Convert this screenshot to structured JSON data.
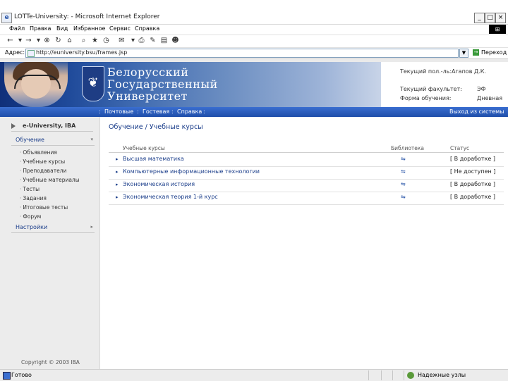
{
  "window": {
    "title": "LOTTe-University: - Microsoft Internet Explorer",
    "minimize": "_",
    "maximize": "□",
    "close": "×"
  },
  "menu": {
    "items": [
      "Файл",
      "Правка",
      "Вид",
      "Избранное",
      "Сервис",
      "Справка"
    ]
  },
  "address": {
    "label": "Адрес:",
    "url": "http://euniversity.bsu/frames.jsp",
    "go_label": "Переход"
  },
  "header": {
    "university_lines": [
      "Белорусский",
      "Государственный",
      "Университет"
    ],
    "user_label": "Текущий пол.-ль:",
    "user_name": "Агапов Д.К.",
    "faculty_label": "Текущий факультет:",
    "faculty_value": "ЭФ",
    "form_label": "Форма обучения:",
    "form_value": "Дневная"
  },
  "nav": {
    "links": [
      "Почтовые",
      "Гостевая",
      "Справка"
    ],
    "logout": "Выход из системы"
  },
  "sidebar": {
    "brand": "e-University, IBA",
    "section_learning": "Обучение",
    "items": [
      "Объявления",
      "Учебные курсы",
      "Преподаватели",
      "Учебные материалы",
      "Тесты",
      "Задания",
      "Итоговые тесты",
      "Форум"
    ],
    "section_settings": "Настройки",
    "copyright": "Copyright © 2003 IBA"
  },
  "main": {
    "breadcrumb": "Обучение / Учебные курсы",
    "columns": [
      "Учебные курсы",
      "Библиотека",
      "Статус"
    ],
    "rows": [
      {
        "course": "Высшая математика",
        "status": "[ В доработке ]"
      },
      {
        "course": "Компьютерные информационные технологии",
        "status": "[ Не доступен ]"
      },
      {
        "course": "Экономическая история",
        "status": "[ В доработке ]"
      },
      {
        "course": "Экономическая теория 1-й курс",
        "status": "[ В доработке ]"
      }
    ]
  },
  "status": {
    "text": "Готово",
    "zone": "Надежные узлы"
  }
}
